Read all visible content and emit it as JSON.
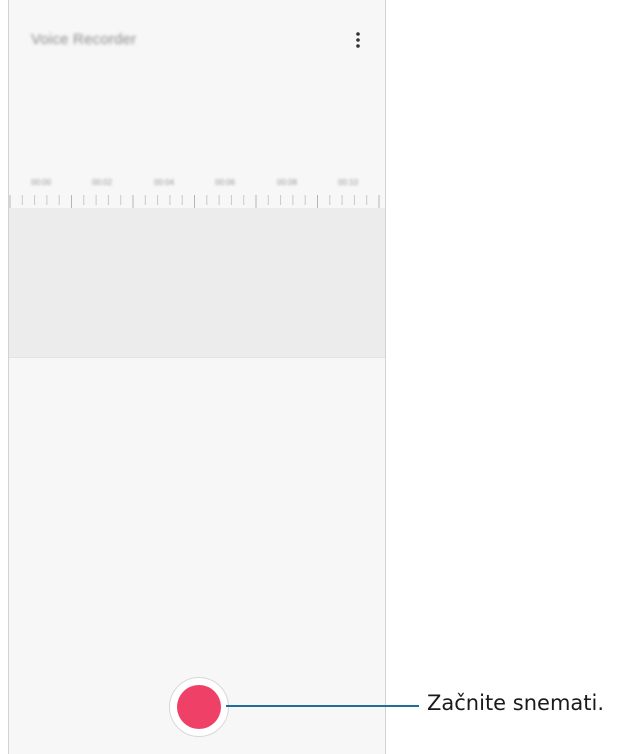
{
  "app": {
    "title": "Voice Recorder"
  },
  "toolbar": {
    "more_icon": "more-vertical-icon"
  },
  "timeline": {
    "tick_labels": [
      "00:00",
      "00:02",
      "00:04",
      "00:06",
      "00:08",
      "00:10"
    ]
  },
  "controls": {
    "record_icon": "record-icon",
    "record_color": "#ef4067"
  },
  "callout": {
    "text": "Začnite snemati.",
    "line_color": "#1f6e99"
  }
}
